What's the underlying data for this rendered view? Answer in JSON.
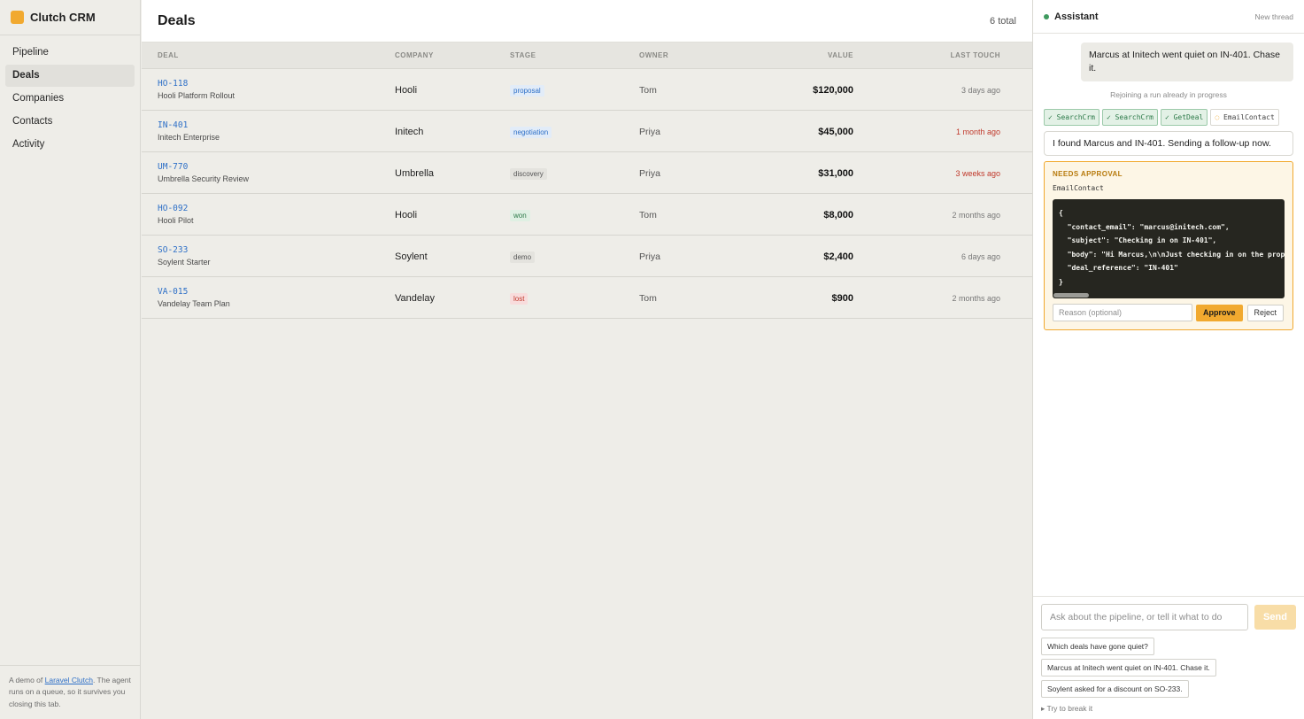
{
  "app": {
    "name": "Clutch CRM",
    "brand_color": "#f1a92f"
  },
  "sidebar": {
    "items": [
      {
        "label": "Pipeline",
        "active": false
      },
      {
        "label": "Deals",
        "active": true
      },
      {
        "label": "Companies",
        "active": false
      },
      {
        "label": "Contacts",
        "active": false
      },
      {
        "label": "Activity",
        "active": false
      }
    ],
    "footer": {
      "prefix": "A demo of ",
      "link": "Laravel Clutch",
      "suffix": ". The agent runs on a queue, so it survives you closing this tab."
    }
  },
  "main": {
    "title": "Deals",
    "count": "6 total",
    "columns": [
      "DEAL",
      "COMPANY",
      "STAGE",
      "OWNER",
      "VALUE",
      "LAST TOUCH"
    ],
    "rows": [
      {
        "id": "HO-118",
        "name": "Hooli Platform Rollout",
        "company": "Hooli",
        "stage": "proposal",
        "owner": "Tom",
        "value": "$120,000",
        "last": "3 days ago"
      },
      {
        "id": "IN-401",
        "name": "Initech Enterprise",
        "company": "Initech",
        "stage": "negotiation",
        "owner": "Priya",
        "value": "$45,000",
        "last": "1 month ago"
      },
      {
        "id": "UM-770",
        "name": "Umbrella Security Review",
        "company": "Umbrella",
        "stage": "discovery",
        "owner": "Priya",
        "value": "$31,000",
        "last": "3 weeks ago"
      },
      {
        "id": "HO-092",
        "name": "Hooli Pilot",
        "company": "Hooli",
        "stage": "won",
        "owner": "Tom",
        "value": "$8,000",
        "last": "2 months ago"
      },
      {
        "id": "SO-233",
        "name": "Soylent Starter",
        "company": "Soylent",
        "stage": "demo",
        "owner": "Priya",
        "value": "$2,400",
        "last": "6 days ago"
      },
      {
        "id": "VA-015",
        "name": "Vandelay Team Plan",
        "company": "Vandelay",
        "stage": "lost",
        "owner": "Tom",
        "value": "$900",
        "last": "2 months ago"
      }
    ],
    "stage_colors": {
      "proposal": {
        "bg": "#e2ecf8",
        "fg": "#2d6fc7"
      },
      "negotiation": {
        "bg": "#e2ecf8",
        "fg": "#2d6fc7"
      },
      "discovery": {
        "bg": "#e4e3de",
        "fg": "#555555"
      },
      "won": {
        "bg": "#dff0e3",
        "fg": "#2d7a49"
      },
      "demo": {
        "bg": "#e4e3de",
        "fg": "#555555"
      },
      "lost": {
        "bg": "#f8dcdc",
        "fg": "#c0392b"
      }
    },
    "overdue_color": "#c0392b"
  },
  "assistant": {
    "title": "Assistant",
    "new_thread": "New thread",
    "user_message": "Marcus at Initech went quiet on IN-401. Chase it.",
    "system_note": "Rejoining a run already in progress",
    "tools": [
      {
        "label": "✓ SearchCrm",
        "status": "done"
      },
      {
        "label": "✓ SearchCrm",
        "status": "done"
      },
      {
        "label": "✓ GetDeal",
        "status": "done"
      },
      {
        "label": "EmailContact",
        "status": "pending"
      }
    ],
    "assistant_message": "I found Marcus and IN-401. Sending a follow-up now.",
    "approval": {
      "label": "NEEDS APPROVAL",
      "tool": "EmailContact",
      "code_lines": [
        "{",
        "  \"contact_email\": \"marcus@initech.com\",",
        "  \"subject\": \"Checking in on IN-401\",",
        "  \"body\": \"Hi Marcus,\\n\\nJust checking in on the proposal\",",
        "  \"deal_reference\": \"IN-401\"",
        "}"
      ],
      "reason_placeholder": "Reason (optional)",
      "approve": "Approve",
      "reject": "Reject"
    },
    "composer": {
      "placeholder": "Ask about the pipeline, or tell it what to do",
      "send": "Send",
      "suggestions": [
        "Which deals have gone quiet?",
        "Marcus at Initech went quiet on IN-401. Chase it.",
        "Soylent asked for a discount on SO-233."
      ],
      "try_break": "▸ Try to break it"
    }
  }
}
